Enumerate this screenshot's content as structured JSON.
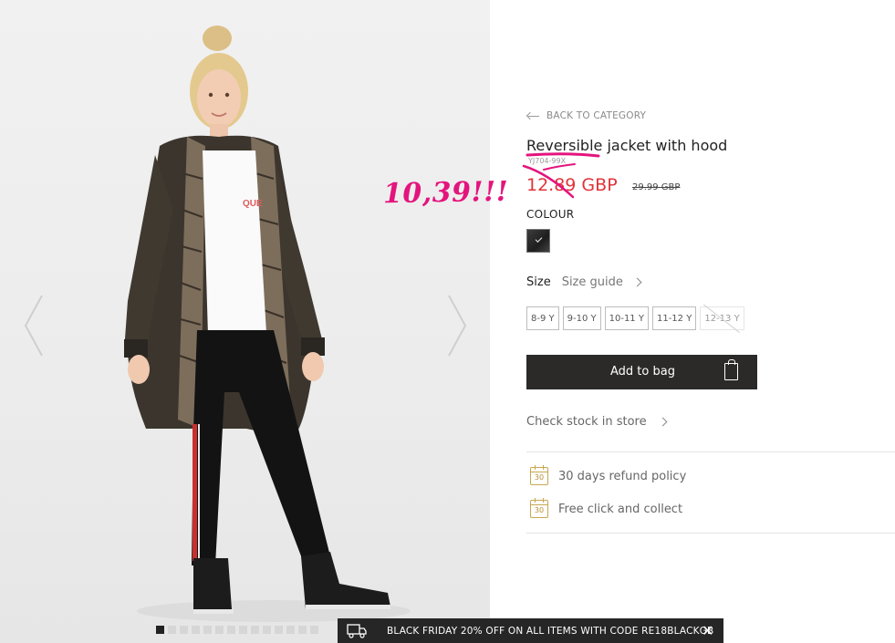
{
  "product": {
    "back_label": "BACK TO CATEGORY",
    "title": "Reversible jacket with hood",
    "sku": "YJ704-99X",
    "price": "12.89 GBP",
    "old_price": "29.99 GBP",
    "colour_label": "COLOUR",
    "size_label": "Size",
    "size_guide": "Size guide",
    "sizes": [
      {
        "label": "8-9 Y",
        "available": true
      },
      {
        "label": "9-10 Y",
        "available": true
      },
      {
        "label": "10-11 Y",
        "available": true
      },
      {
        "label": "11-12 Y",
        "available": true
      },
      {
        "label": "12-13 Y",
        "available": false
      }
    ],
    "add_to_bag": "Add to bag",
    "check_stock": "Check stock in store",
    "perks": [
      "30 days refund policy",
      "Free click and collect"
    ],
    "calendar_number": "30"
  },
  "gallery": {
    "dot_count": 14,
    "active_dot": 0,
    "tshirt_text": "QUE"
  },
  "annotation": {
    "text": "10,39!!!",
    "color": "#e4147d"
  },
  "promo": {
    "text": "BLACK FRIDAY 20% OFF ON ALL ITEMS WITH CODE RE18BLACKGB",
    "close": "✕"
  },
  "colors": {
    "price_red": "#e0343a",
    "button_dark": "#2b2a29",
    "accent_gold": "#c9a650"
  }
}
